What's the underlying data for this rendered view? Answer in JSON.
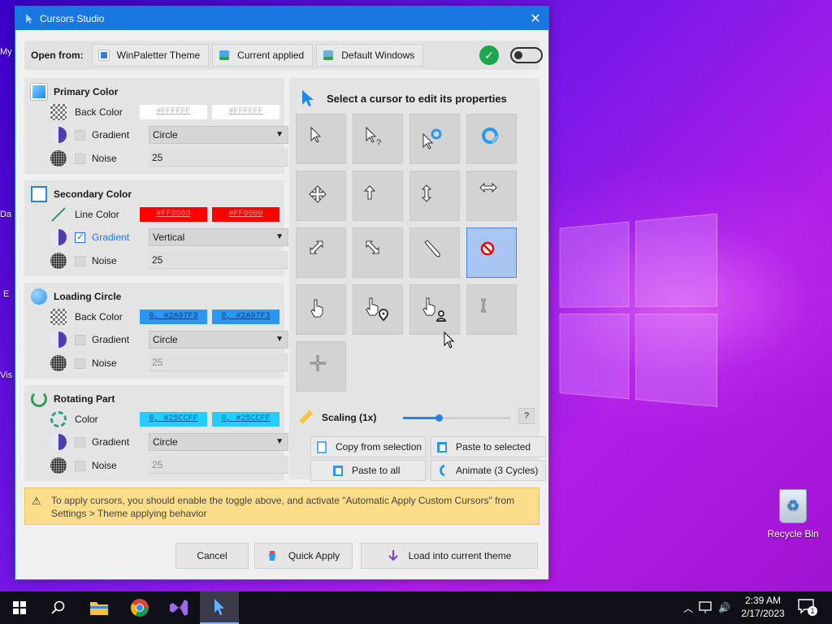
{
  "window": {
    "title": "Cursors Studio",
    "accent": "#1877e0"
  },
  "open_from": {
    "label": "Open from:",
    "sources": [
      "WinPaletter Theme",
      "Current applied",
      "Default Windows"
    ]
  },
  "panels": {
    "primary": {
      "title": "Primary Color",
      "back_color_label": "Back Color",
      "back_color_values": [
        "#FFFFFF",
        "#FFFFFF"
      ],
      "gradient_label": "Gradient",
      "gradient_value": "Circle",
      "noise_label": "Noise",
      "noise_value": "25"
    },
    "secondary": {
      "title": "Secondary Color",
      "line_color_label": "Line Color",
      "line_color_values": [
        "#FF0000",
        "#FF0000"
      ],
      "gradient_label": "Gradient",
      "gradient_value": "Vertical",
      "noise_label": "Noise",
      "noise_value": "25"
    },
    "loading": {
      "title": "Loading Circle",
      "back_color_label": "Back Color",
      "back_color_values": [
        "0, #2A97F3",
        "0, #2A97F3"
      ],
      "gradient_label": "Gradient",
      "gradient_value": "Circle",
      "noise_label": "Noise",
      "noise_value": "25"
    },
    "rotating": {
      "title": "Rotating Part",
      "color_label": "Color",
      "color_values": [
        "0, #25CCFF",
        "0, #25CCFF"
      ],
      "gradient_label": "Gradient",
      "gradient_value": "Circle",
      "noise_label": "Noise",
      "noise_value": "25"
    }
  },
  "cursors": {
    "title": "Select a cursor to edit its properties",
    "items": [
      "arrow",
      "help",
      "app-starting",
      "busy",
      "move",
      "up-arrow",
      "vertical-resize",
      "horizontal-resize",
      "diagonal-resize-1",
      "diagonal-resize-2",
      "pen",
      "unavailable",
      "hand",
      "pin",
      "person",
      "text-select",
      "precision-select"
    ],
    "selected": "unavailable"
  },
  "scaling": {
    "label": "Scaling (1x)",
    "help": "?",
    "level": 0.33
  },
  "actions": {
    "copy_from_selection": "Copy from selection",
    "paste_to_selected": "Paste to selected",
    "paste_to_all": "Paste to all",
    "animate": "Animate (3 Cycles)"
  },
  "warning": "To apply cursors, you should enable the toggle above, and activate \"Automatic Apply Custom Cursors\" from Settings > Theme applying behavior",
  "footer": {
    "cancel": "Cancel",
    "quick_apply": "Quick Apply",
    "load_into_theme": "Load into current theme"
  },
  "desktop": {
    "recycle_bin": "Recycle Bin",
    "partial_labels": [
      "My",
      "Da",
      "E",
      "Vis"
    ]
  },
  "taskbar": {
    "time": "2:39 AM",
    "date": "2/17/2023",
    "notification_count": "1"
  }
}
